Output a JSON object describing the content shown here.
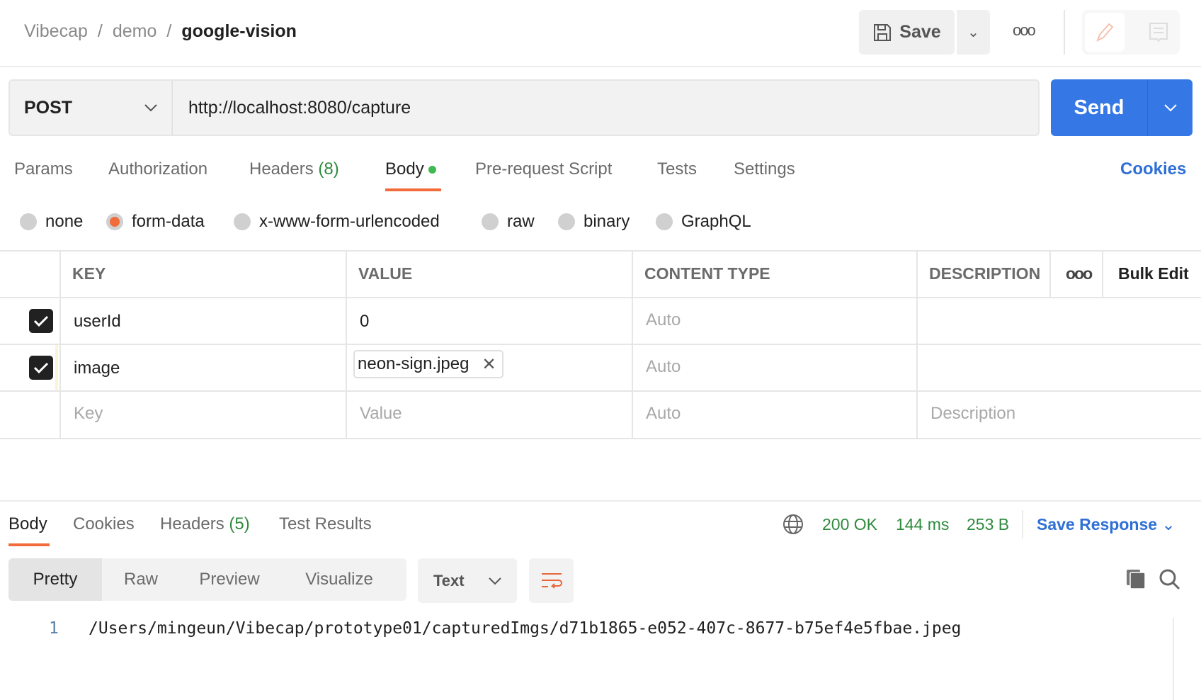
{
  "breadcrumb": {
    "workspace": "Vibecap",
    "collection": "demo",
    "request": "google-vision",
    "sep": "/"
  },
  "header": {
    "save_label": "Save",
    "more": "ooo"
  },
  "request": {
    "method": "POST",
    "url": "http://localhost:8080/capture",
    "send_label": "Send"
  },
  "tabs": {
    "params": "Params",
    "authorization": "Authorization",
    "headers": "Headers",
    "headers_count": "(8)",
    "body": "Body",
    "prerequest": "Pre-request Script",
    "tests": "Tests",
    "settings": "Settings",
    "cookies": "Cookies"
  },
  "body_types": {
    "none": "none",
    "form_data": "form-data",
    "urlencoded": "x-www-form-urlencoded",
    "raw": "raw",
    "binary": "binary",
    "graphql": "GraphQL",
    "selected": "form-data"
  },
  "table": {
    "headers": {
      "key": "KEY",
      "value": "VALUE",
      "content_type": "CONTENT TYPE",
      "description": "DESCRIPTION",
      "more": "ooo",
      "bulk_edit": "Bulk Edit"
    },
    "rows": [
      {
        "key": "userId",
        "value": "0",
        "content_type": "Auto",
        "checked": true
      },
      {
        "key": "image",
        "value": "neon-sign.jpeg",
        "content_type": "Auto",
        "checked": true
      }
    ],
    "placeholder": {
      "key": "Key",
      "value": "Value",
      "content_type": "Auto",
      "description": "Description"
    }
  },
  "response": {
    "tabs": {
      "body": "Body",
      "cookies": "Cookies",
      "headers": "Headers",
      "headers_count": "(5)",
      "test_results": "Test Results"
    },
    "status": "200 OK",
    "time": "144 ms",
    "size": "253 B",
    "save_response": "Save Response",
    "views": {
      "pretty": "Pretty",
      "raw": "Raw",
      "preview": "Preview",
      "visualize": "Visualize"
    },
    "format": "Text",
    "lines": [
      {
        "num": "1",
        "text": "/Users/mingeun/Vibecap/prototype01/capturedImgs/d71b1865-e052-407c-8677-b75ef4e5fbae.jpeg"
      }
    ]
  },
  "colors": {
    "accent": "#f26b3a",
    "send": "#3578e5",
    "status_ok": "#2e8b3d",
    "link": "#2f6fd6"
  }
}
